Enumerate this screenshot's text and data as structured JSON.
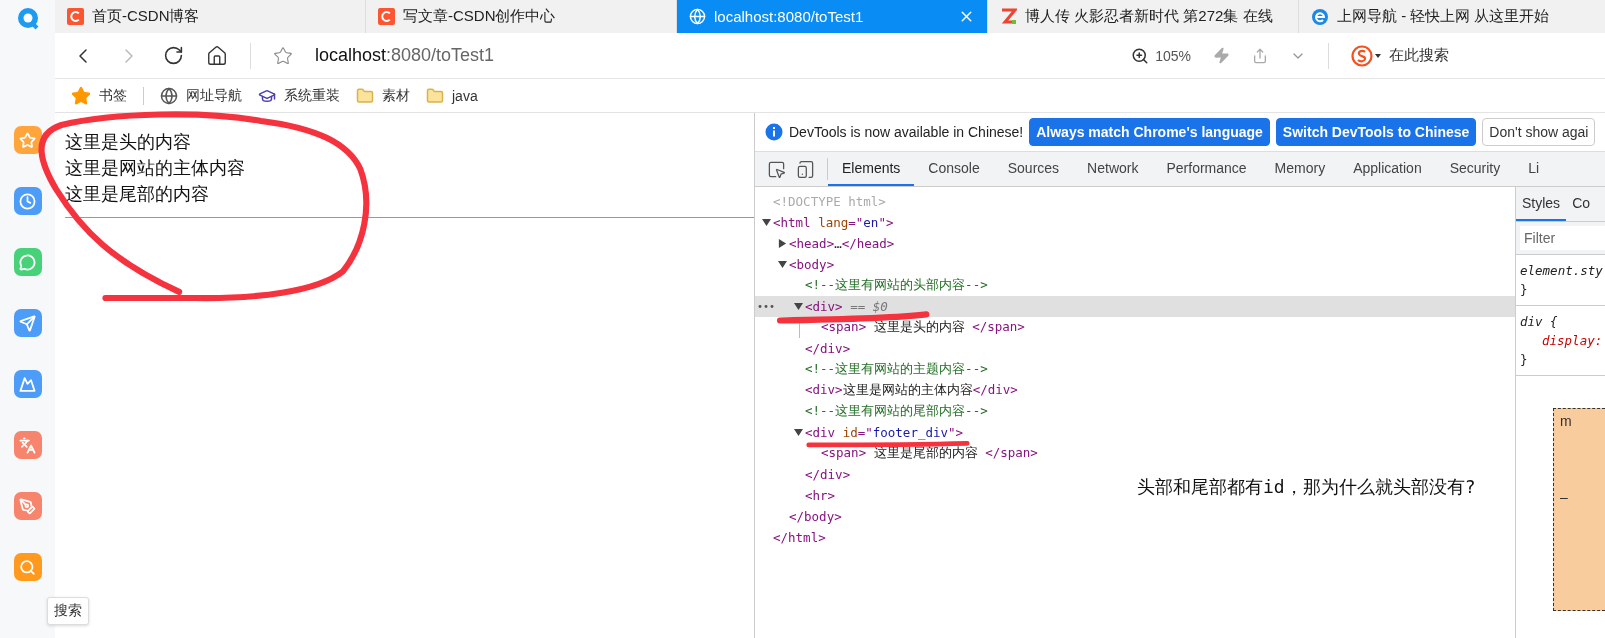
{
  "browser_tabs": [
    {
      "kind": "csdn",
      "title": "首页-CSDN博客",
      "selected": false
    },
    {
      "kind": "csdn",
      "title": "写文章-CSDN创作中心",
      "selected": false
    },
    {
      "kind": "globe",
      "title": "localhost:8080/toTest1",
      "selected": true
    },
    {
      "kind": "zletter",
      "title": "博人传 火影忍者新时代 第272集 在线",
      "selected": false
    },
    {
      "kind": "ie",
      "title": "上网导航 - 轻快上网 从这里开始",
      "selected": false
    }
  ],
  "address_bar": {
    "host": "localhost",
    "path": ":8080/toTest1",
    "zoom": "105%"
  },
  "search_box": {
    "placeholder": "在此搜索"
  },
  "bookmarks": [
    {
      "kind": "star",
      "label": "书签"
    },
    {
      "kind": "globe",
      "label": "网址导航"
    },
    {
      "kind": "hat",
      "label": "系统重装"
    },
    {
      "kind": "folder",
      "label": "素材"
    },
    {
      "kind": "folder",
      "label": "java"
    }
  ],
  "side_tooltip": "搜索",
  "page_lines": [
    "这里是头的内容",
    "这里是网站的主体内容",
    "这里是尾部的内容"
  ],
  "devtools": {
    "infobar": {
      "message": "DevTools is now available in Chinese!",
      "buttons": [
        {
          "label": "Always match Chrome's language",
          "kind": "primary"
        },
        {
          "label": "Switch DevTools to Chinese",
          "kind": "primary"
        },
        {
          "label": "Don't show agai",
          "kind": "plain"
        }
      ]
    },
    "tabs": [
      {
        "label": "Elements",
        "selected": true
      },
      {
        "label": "Console",
        "selected": false
      },
      {
        "label": "Sources",
        "selected": false
      },
      {
        "label": "Network",
        "selected": false
      },
      {
        "label": "Performance",
        "selected": false
      },
      {
        "label": "Memory",
        "selected": false
      },
      {
        "label": "Application",
        "selected": false
      },
      {
        "label": "Security",
        "selected": false
      },
      {
        "label": "Li",
        "selected": false
      }
    ],
    "row_dots": "•••",
    "dom": [
      {
        "selected": false,
        "open": [
          {
            "kind": "doctype",
            "text": "<!DOCTYPE html>"
          }
        ]
      },
      {
        "selected": false,
        "expanded": true,
        "open": [
          {
            "kind": "tag",
            "text": "<html "
          },
          {
            "kind": "attr",
            "text": "lang"
          },
          {
            "kind": "tag",
            "text": "=\""
          },
          {
            "kind": "value",
            "text": "en"
          },
          {
            "kind": "tag",
            "text": "\">"
          }
        ],
        "close": [
          {
            "kind": "tag",
            "text": "</html>"
          }
        ],
        "children": [
          {
            "selected": false,
            "expanded": false,
            "open": [
              {
                "kind": "tag",
                "text": "<head>"
              },
              {
                "kind": "text",
                "text": "…"
              },
              {
                "kind": "tag",
                "text": "</head>"
              }
            ]
          },
          {
            "selected": false,
            "expanded": true,
            "open": [
              {
                "kind": "tag",
                "text": "<body>"
              }
            ],
            "close": [
              {
                "kind": "tag",
                "text": "</body>"
              }
            ],
            "children": [
              {
                "selected": false,
                "open": [
                  {
                    "kind": "comment",
                    "text": "<!--这里有网站的头部内容-->"
                  }
                ]
              },
              {
                "selected": true,
                "expanded": true,
                "open": [
                  {
                    "kind": "tag",
                    "text": "<div>"
                  },
                  {
                    "kind": "ref",
                    "text": " == $0"
                  }
                ],
                "close": [
                  {
                    "kind": "tag",
                    "text": "</div>"
                  }
                ],
                "children": [
                  {
                    "selected": false,
                    "open": [
                      {
                        "kind": "tag",
                        "text": "<span>"
                      },
                      {
                        "kind": "text",
                        "text": " 这里是头的内容 "
                      },
                      {
                        "kind": "tag",
                        "text": "</span>"
                      }
                    ]
                  }
                ]
              },
              {
                "selected": false,
                "open": [
                  {
                    "kind": "comment",
                    "text": "<!--这里有网站的主题内容-->"
                  }
                ]
              },
              {
                "selected": false,
                "open": [
                  {
                    "kind": "tag",
                    "text": "<div>"
                  },
                  {
                    "kind": "text",
                    "text": "这里是网站的主体内容"
                  },
                  {
                    "kind": "tag",
                    "text": "</div>"
                  }
                ]
              },
              {
                "selected": false,
                "open": [
                  {
                    "kind": "comment",
                    "text": "<!--这里有网站的尾部内容-->"
                  }
                ]
              },
              {
                "selected": false,
                "expanded": true,
                "open": [
                  {
                    "kind": "tag",
                    "text": "<div "
                  },
                  {
                    "kind": "attr",
                    "text": "id"
                  },
                  {
                    "kind": "tag",
                    "text": "=\""
                  },
                  {
                    "kind": "value",
                    "text": "footer_div"
                  },
                  {
                    "kind": "tag",
                    "text": "\">"
                  }
                ],
                "close": [
                  {
                    "kind": "tag",
                    "text": "</div>"
                  }
                ],
                "children": [
                  {
                    "selected": false,
                    "open": [
                      {
                        "kind": "tag",
                        "text": "<span>"
                      },
                      {
                        "kind": "text",
                        "text": " 这里是尾部的内容 "
                      },
                      {
                        "kind": "tag",
                        "text": "</span>"
                      }
                    ]
                  }
                ]
              },
              {
                "selected": false,
                "open": [
                  {
                    "kind": "tag",
                    "text": "<hr>"
                  }
                ]
              }
            ]
          }
        ]
      }
    ],
    "note": "头部和尾部都有id，那为什么就头部没有?",
    "styles": {
      "tabs": [
        {
          "label": "Styles",
          "selected": true
        },
        {
          "label": "Co",
          "selected": false
        }
      ],
      "filter": {
        "placeholder": "Filter"
      },
      "rules": [
        [
          {
            "kind": "selector",
            "text": "element.sty"
          },
          {
            "kind": "brace",
            "text": "}"
          }
        ],
        [
          {
            "kind": "selector",
            "text": "div {"
          },
          {
            "kind": "property",
            "text": "display:"
          },
          {
            "kind": "brace",
            "text": "}"
          }
        ]
      ],
      "box_model": {
        "label": "m",
        "dash": "–"
      }
    }
  }
}
